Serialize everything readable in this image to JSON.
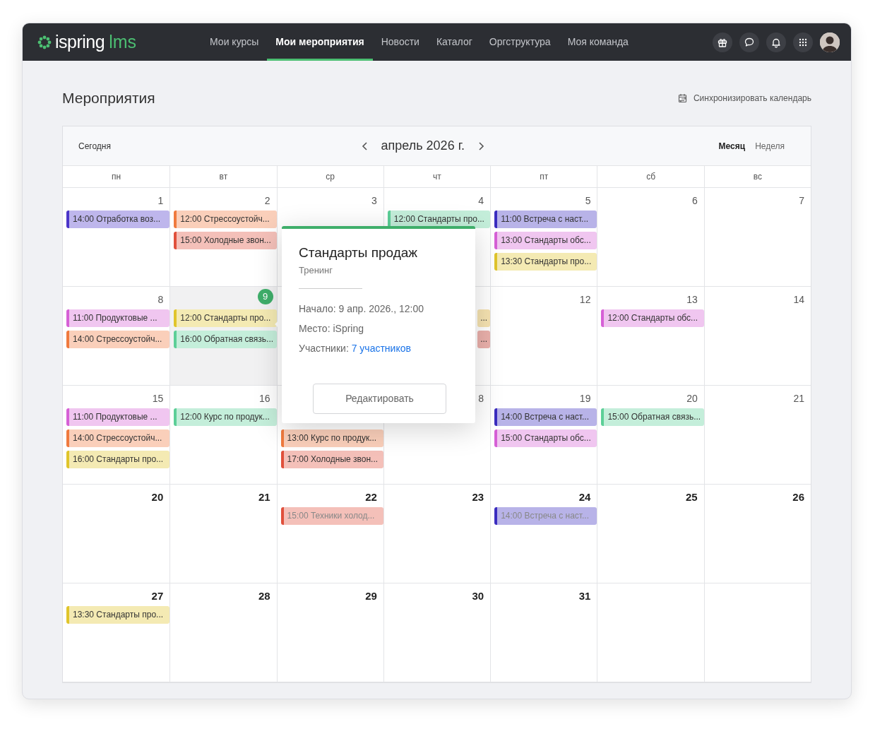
{
  "navbar": {
    "logo": {
      "name": "ispring",
      "suffix": "lms"
    },
    "items": [
      {
        "label": "Мои курсы",
        "selected": false
      },
      {
        "label": "Мои мероприятия",
        "selected": true
      },
      {
        "label": "Новости",
        "selected": false
      },
      {
        "label": "Каталог",
        "selected": false
      },
      {
        "label": "Оргструктура",
        "selected": false
      },
      {
        "label": "Моя команда",
        "selected": false
      }
    ],
    "actions": [
      {
        "kind": "gift"
      },
      {
        "kind": "chat"
      },
      {
        "kind": "bell"
      },
      {
        "kind": "apps"
      },
      {
        "kind": "avatar"
      }
    ]
  },
  "page": {
    "title": "Мероприятия",
    "sync_link": "Синхронизировать календарь"
  },
  "calendar": {
    "today_button": "Сегодня",
    "month_label": "апрель 2026 г.",
    "views": [
      {
        "label": "Месяц",
        "selected": true
      },
      {
        "label": "Неделя",
        "selected": false
      }
    ],
    "weekdays": [
      "пн",
      "вт",
      "ср",
      "чт",
      "пт",
      "сб",
      "вс"
    ],
    "weeks": [
      {
        "bold_numbers": false,
        "days": [
          {
            "number": "1",
            "today": false,
            "events": [
              {
                "text": "14:00 Отработка воз...",
                "color": "#4b35c9",
                "faded": false,
                "clipped": false
              }
            ]
          },
          {
            "number": "2",
            "today": false,
            "events": [
              {
                "text": "12:00 Стрессоустойч...",
                "color": "#f07a3e",
                "faded": false,
                "clipped": false
              },
              {
                "text": "15:00 Холодные звон...",
                "color": "#e0503c",
                "faded": false,
                "clipped": false
              }
            ]
          },
          {
            "number": "3",
            "today": false
          },
          {
            "number": "4",
            "today": false,
            "events": [
              {
                "text": "12:00 Стандарты про...",
                "color": "#5ccf97",
                "faded": false,
                "clipped": false
              }
            ]
          },
          {
            "number": "5",
            "today": false,
            "events": [
              {
                "text": "11:00 Встреча с наст...",
                "color": "#3b2dbf",
                "faded": false,
                "clipped": false
              },
              {
                "text": "13:00 Стандарты обс...",
                "color": "#d660d6",
                "faded": false,
                "clipped": false
              },
              {
                "text": "13:30 Стандарты про...",
                "color": "#e0c52b",
                "faded": false,
                "clipped": false
              }
            ]
          },
          {
            "number": "6",
            "today": false
          },
          {
            "number": "7",
            "today": false
          }
        ]
      },
      {
        "bold_numbers": false,
        "days": [
          {
            "number": "8",
            "today": false,
            "events": [
              {
                "text": "11:00 Продуктовые  ...",
                "color": "#d660d6",
                "faded": false,
                "clipped": false
              },
              {
                "text": "14:00 Стрессоустойч...",
                "color": "#f07a3e",
                "faded": false,
                "clipped": false
              }
            ]
          },
          {
            "number": "9",
            "today": true,
            "events": [
              {
                "text": "12:00 Стандарты про...",
                "color": "#e0c52b",
                "faded": false,
                "clipped": false
              },
              {
                "text": "16:00 Обратная связь...",
                "color": "#5ccf97",
                "faded": false,
                "clipped": false
              }
            ]
          },
          {
            "today": false
          },
          {
            "today": false,
            "events": [
              {
                "text": "...",
                "color": "#f5e2b0",
                "faded": false,
                "clipped": true
              },
              {
                "text": "...",
                "color": "#eab0ab",
                "faded": false,
                "clipped": true
              }
            ]
          },
          {
            "number": "12",
            "today": false
          },
          {
            "number": "13",
            "today": false,
            "events": [
              {
                "text": "12:00 Стандарты обс...",
                "color": "#d660d6",
                "faded": false,
                "clipped": false
              }
            ]
          },
          {
            "number": "14",
            "today": false
          }
        ]
      },
      {
        "bold_numbers": false,
        "days": [
          {
            "number": "15",
            "today": false,
            "events": [
              {
                "text": "11:00 Продуктовые  ...",
                "color": "#d660d6",
                "faded": false,
                "clipped": false
              },
              {
                "text": "14:00 Стрессоустойч...",
                "color": "#f07a3e",
                "faded": false,
                "clipped": false
              },
              {
                "text": "16:00 Стандарты про...",
                "color": "#e0c52b",
                "faded": false,
                "clipped": false
              }
            ]
          },
          {
            "number": "16",
            "today": false,
            "events": [
              {
                "text": "12:00 Курс по продук...",
                "color": "#5ccf97",
                "faded": false,
                "clipped": false
              }
            ]
          },
          {
            "today": false,
            "events": [
              {
                "text": "13:00 Курс по продук...",
                "color": "#f07a3e",
                "faded": false,
                "clipped": false
              },
              {
                "text": "17:00 Холодные звон...",
                "color": "#e0503c",
                "faded": false,
                "clipped": false
              }
            ]
          },
          {
            "number": "8",
            "today": false
          },
          {
            "number": "19",
            "today": false,
            "events": [
              {
                "text": "14:00 Встреча с наст...",
                "color": "#3b2dbf",
                "faded": false,
                "clipped": false
              },
              {
                "text": "15:00 Стандарты обс...",
                "color": "#d660d6",
                "faded": false,
                "clipped": false
              }
            ]
          },
          {
            "number": "20",
            "today": false,
            "events": [
              {
                "text": "15:00 Обратная связь...",
                "color": "#5ccf97",
                "faded": false,
                "clipped": false
              }
            ]
          },
          {
            "number": "21",
            "today": false
          }
        ]
      },
      {
        "bold_numbers": true,
        "days": [
          {
            "number": "20",
            "today": false
          },
          {
            "number": "21",
            "today": false
          },
          {
            "number": "22",
            "today": false,
            "events": [
              {
                "text": "15:00 Техники холод...",
                "color": "#e0503c",
                "faded": true,
                "clipped": false
              }
            ]
          },
          {
            "number": "23",
            "today": false
          },
          {
            "number": "24",
            "today": false,
            "events": [
              {
                "text": "14:00 Встреча с наст...",
                "color": "#3b2dbf",
                "faded": true,
                "clipped": false
              }
            ]
          },
          {
            "number": "25",
            "today": false
          },
          {
            "number": "26",
            "today": false
          }
        ]
      },
      {
        "bold_numbers": true,
        "days": [
          {
            "number": "27",
            "today": false,
            "events": [
              {
                "text": "13:30 Стандарты про...",
                "color": "#e0c52b",
                "faded": false,
                "clipped": false
              }
            ]
          },
          {
            "number": "28",
            "today": false
          },
          {
            "number": "29",
            "today": false
          },
          {
            "number": "30",
            "today": false
          },
          {
            "number": "31",
            "today": false
          },
          {
            "today": false
          },
          {
            "today": false
          }
        ]
      }
    ]
  },
  "popover": {
    "title": "Стандарты продаж",
    "subtitle": "Тренинг",
    "lines": [
      {
        "label": "Начало:",
        "value": "9 апр. 2026., 12:00",
        "kind": "text"
      },
      {
        "label": "Место:",
        "value": "iSpring",
        "kind": "text"
      },
      {
        "label": "Участники:",
        "value": "7 участников",
        "kind": "link"
      }
    ],
    "button": "Редактировать"
  }
}
